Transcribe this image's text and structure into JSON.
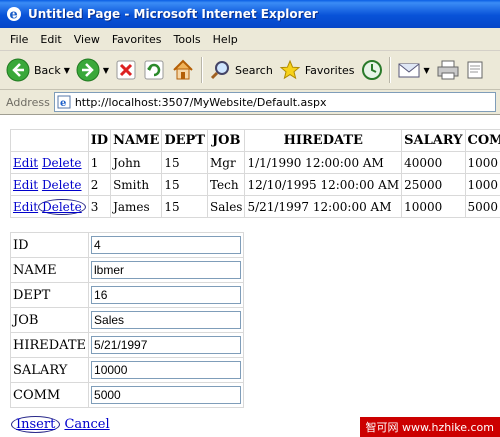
{
  "window": {
    "title": "Untitled Page - Microsoft Internet Explorer"
  },
  "menu": {
    "items": [
      {
        "label": "File",
        "key": "F"
      },
      {
        "label": "Edit",
        "key": "E"
      },
      {
        "label": "View",
        "key": "V"
      },
      {
        "label": "Favorites",
        "key": "a"
      },
      {
        "label": "Tools",
        "key": "T"
      },
      {
        "label": "Help",
        "key": "H"
      }
    ]
  },
  "toolbar": {
    "back_label": "Back",
    "search_label": "Search",
    "favorites_label": "Favorites"
  },
  "address": {
    "label": "Address",
    "url": "http://localhost:3507/MyWebsite/Default.aspx"
  },
  "grid": {
    "headers": [
      "ID",
      "NAME",
      "DEPT",
      "JOB",
      "HIREDATE",
      "SALARY",
      "COMM"
    ],
    "edit_label": "Edit",
    "delete_label": "Delete",
    "rows": [
      {
        "id": "1",
        "name": "John",
        "dept": "15",
        "job": "Mgr",
        "hiredate": "1/1/1990 12:00:00 AM",
        "salary": "40000",
        "comm": "1000"
      },
      {
        "id": "2",
        "name": "Smith",
        "dept": "15",
        "job": "Tech",
        "hiredate": "12/10/1995 12:00:00 AM",
        "salary": "25000",
        "comm": "1000"
      },
      {
        "id": "3",
        "name": "James",
        "dept": "15",
        "job": "Sales",
        "hiredate": "5/21/1997 12:00:00 AM",
        "salary": "10000",
        "comm": "5000"
      }
    ]
  },
  "form": {
    "fields": [
      {
        "label": "ID",
        "value": "4"
      },
      {
        "label": "NAME",
        "value": "lbmer"
      },
      {
        "label": "DEPT",
        "value": "16"
      },
      {
        "label": "JOB",
        "value": "Sales"
      },
      {
        "label": "HIREDATE",
        "value": "5/21/1997"
      },
      {
        "label": "SALARY",
        "value": "10000"
      },
      {
        "label": "COMM",
        "value": "5000"
      }
    ],
    "insert_label": "Insert",
    "cancel_label": "Cancel"
  },
  "watermark": {
    "text": "智可网 www.hzhike.com"
  }
}
